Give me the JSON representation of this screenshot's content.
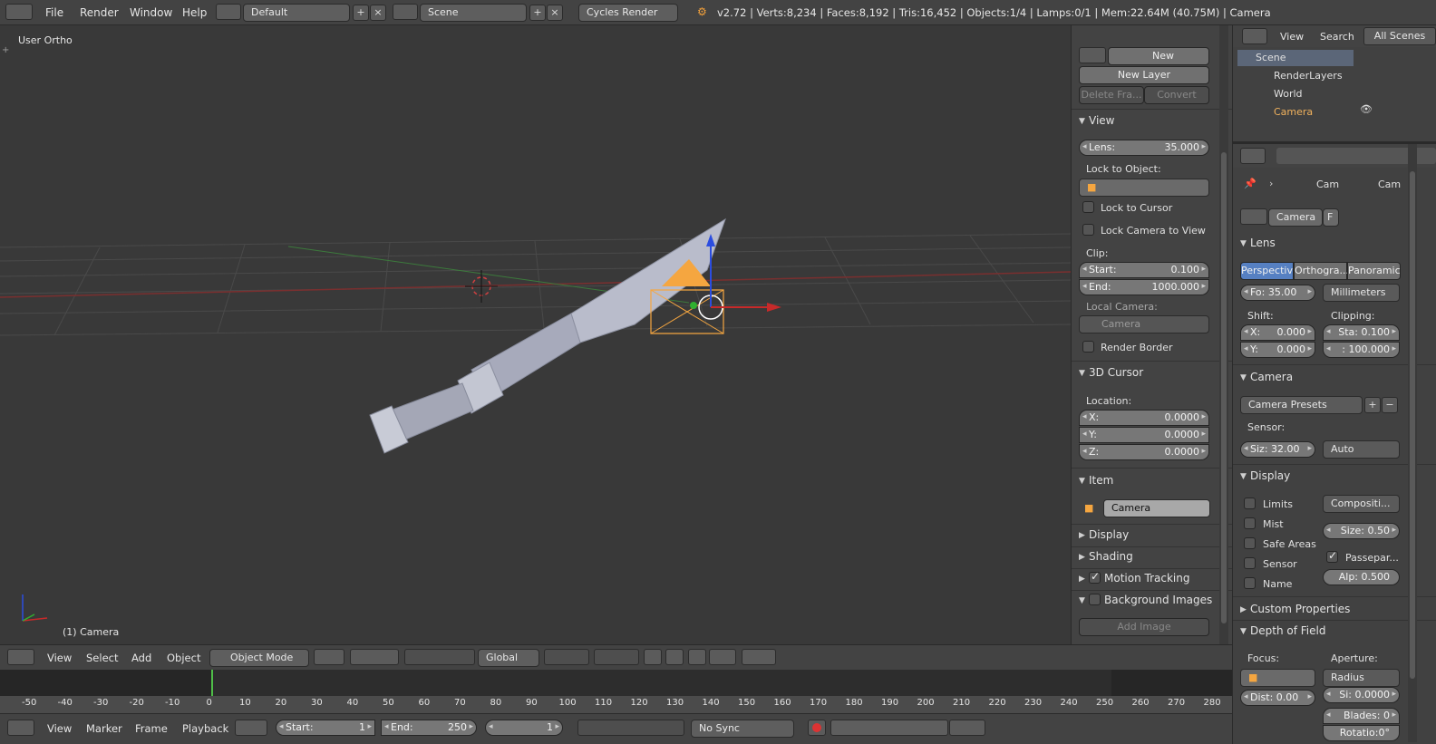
{
  "topbar": {
    "menus": [
      "File",
      "Render",
      "Window",
      "Help"
    ],
    "layout": "Default",
    "scene": "Scene",
    "engine": "Cycles Render",
    "stats": "v2.72 | Verts:8,234 | Faces:8,192 | Tris:16,452 | Objects:1/4 | Lamps:0/1 | Mem:22.64M (40.75M) | Camera"
  },
  "viewport": {
    "view_name": "User Ortho",
    "object_label": "(1) Camera"
  },
  "npanel": {
    "grease_pencil": {
      "new": "New",
      "new_layer": "New Layer",
      "delete_frame": "Delete Fra...",
      "convert": "Convert"
    },
    "view": {
      "title": "View",
      "lens_label": "Lens:",
      "lens_value": "35.000",
      "lock_to_object": "Lock to Object:",
      "lock_to_cursor": "Lock to Cursor",
      "lock_camera_to_view": "Lock Camera to View",
      "clip": "Clip:",
      "start_label": "Start:",
      "start_value": "0.100",
      "end_label": "End:",
      "end_value": "1000.000",
      "local_camera": "Local Camera:",
      "camera_field": "Camera",
      "render_border": "Render Border"
    },
    "cursor": {
      "title": "3D Cursor",
      "location": "Location:",
      "x_label": "X:",
      "x": "0.0000",
      "y_label": "Y:",
      "y": "0.0000",
      "z_label": "Z:",
      "z": "0.0000"
    },
    "item": {
      "title": "Item",
      "name": "Camera"
    },
    "collapsed": [
      "Display",
      "Shading",
      "Motion Tracking",
      "Background Images"
    ],
    "motion_tracking_checked": true,
    "add_image": "Add Image"
  },
  "outliner": {
    "view": "View",
    "search": "Search",
    "all_scenes": "All Scenes",
    "items": [
      "Scene",
      "RenderLayers",
      "World",
      "Camera"
    ]
  },
  "properties": {
    "breadcrumb": [
      "Cam",
      "Cam"
    ],
    "camera_name": "Camera",
    "f_label": "F",
    "lens": {
      "title": "Lens",
      "tabs": [
        "Perspectiv",
        "Orthogra...",
        "Panoramic"
      ],
      "focal": "Fo: 35.00",
      "unit": "Millimeters",
      "shift": "Shift:",
      "clipping": "Clipping:",
      "shift_x": "X:",
      "shift_x_value": "0.000",
      "shift_y": "Y:",
      "shift_y_value": "0.000",
      "clip_start": "Sta: 0.100",
      "clip_end": ": 100.000"
    },
    "camera": {
      "title": "Camera",
      "presets": "Camera Presets",
      "sensor": "Sensor:",
      "size": "Siz: 32.00",
      "fit": "Auto"
    },
    "display": {
      "title": "Display",
      "limits": "Limits",
      "mist": "Mist",
      "safe_areas": "Safe Areas",
      "sensor": "Sensor",
      "name": "Name",
      "composition": "Compositi...",
      "size": "Size: 0.50",
      "passepartout": "Passepar...",
      "alpha": "Alp: 0.500"
    },
    "custom_properties": "Custom Properties",
    "dof": {
      "title": "Depth of Field",
      "focus": "Focus:",
      "aperture": "Aperture:",
      "radius": "Radius",
      "distance": "Dist: 0.00",
      "size": "Si: 0.0000",
      "blades": "Blades: 0",
      "rotation": "Rotatio:0°"
    }
  },
  "header3d": {
    "menus": [
      "View",
      "Select",
      "Add",
      "Object"
    ],
    "mode": "Object Mode",
    "orientation": "Global"
  },
  "timeline": {
    "ticks": [
      "-50",
      "-40",
      "-30",
      "-20",
      "-10",
      "0",
      "10",
      "20",
      "30",
      "40",
      "50",
      "60",
      "70",
      "80",
      "90",
      "100",
      "110",
      "120",
      "130",
      "140",
      "150",
      "160",
      "170",
      "180",
      "190",
      "200",
      "210",
      "220",
      "230",
      "240",
      "250",
      "260",
      "270",
      "280"
    ],
    "menus": [
      "View",
      "Marker",
      "Frame",
      "Playback"
    ],
    "start_label": "Start:",
    "start": "1",
    "end_label": "End:",
    "end": "250",
    "current": "1",
    "sync": "No Sync"
  }
}
